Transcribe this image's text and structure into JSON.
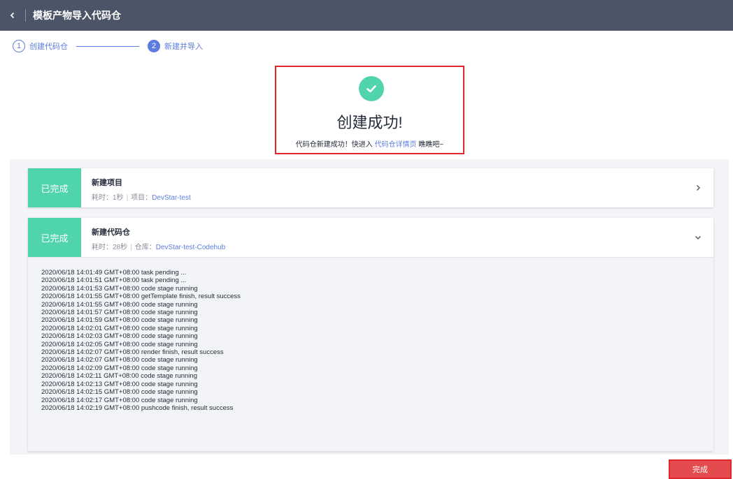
{
  "header": {
    "title": "模板产物导入代码仓"
  },
  "steps": [
    {
      "number": "1",
      "label": "创建代码仓"
    },
    {
      "number": "2",
      "label": "新建并导入"
    }
  ],
  "success": {
    "title": "创建成功!",
    "desc_prefix": "代码仓新建成功！快进入 ",
    "desc_link": "代码仓详情页",
    "desc_suffix": " 瞧瞧吧~"
  },
  "tasks": [
    {
      "status": "已完成",
      "name": "新建项目",
      "time_label": "耗时：",
      "time": "1秒",
      "key_label": "项目：",
      "key_value": "DevStar-test"
    },
    {
      "status": "已完成",
      "name": "新建代码仓",
      "time_label": "耗时：",
      "time": "28秒",
      "key_label": "仓库：",
      "key_value": "DevStar-test-Codehub"
    }
  ],
  "log_lines": [
    "2020/06/18 14:01:49 GMT+08:00 task pending ...",
    "2020/06/18 14:01:51 GMT+08:00 task pending ...",
    "2020/06/18 14:01:53 GMT+08:00 code stage running",
    "2020/06/18 14:01:55 GMT+08:00 getTemplate finish, result success",
    "2020/06/18 14:01:55 GMT+08:00 code stage running",
    "2020/06/18 14:01:57 GMT+08:00 code stage running",
    "2020/06/18 14:01:59 GMT+08:00 code stage running",
    "2020/06/18 14:02:01 GMT+08:00 code stage running",
    "2020/06/18 14:02:03 GMT+08:00 code stage running",
    "2020/06/18 14:02:05 GMT+08:00 code stage running",
    "2020/06/18 14:02:07 GMT+08:00 render finish, result success",
    "2020/06/18 14:02:07 GMT+08:00 code stage running",
    "2020/06/18 14:02:09 GMT+08:00 code stage running",
    "2020/06/18 14:02:11 GMT+08:00 code stage running",
    "2020/06/18 14:02:13 GMT+08:00 code stage running",
    "2020/06/18 14:02:15 GMT+08:00 code stage running",
    "2020/06/18 14:02:17 GMT+08:00 code stage running",
    "2020/06/18 14:02:19 GMT+08:00 pushcode finish, result success"
  ],
  "footer": {
    "done_label": "完成"
  },
  "icons": {
    "back": "chevron-left-icon",
    "success": "check-circle-icon",
    "expand": "chevron-right-icon",
    "collapse": "chevron-down-icon"
  },
  "colors": {
    "topbar": "#4c5567",
    "accent": "#5e7ce0",
    "success": "#50d4ab",
    "danger": "#e34b4e"
  }
}
